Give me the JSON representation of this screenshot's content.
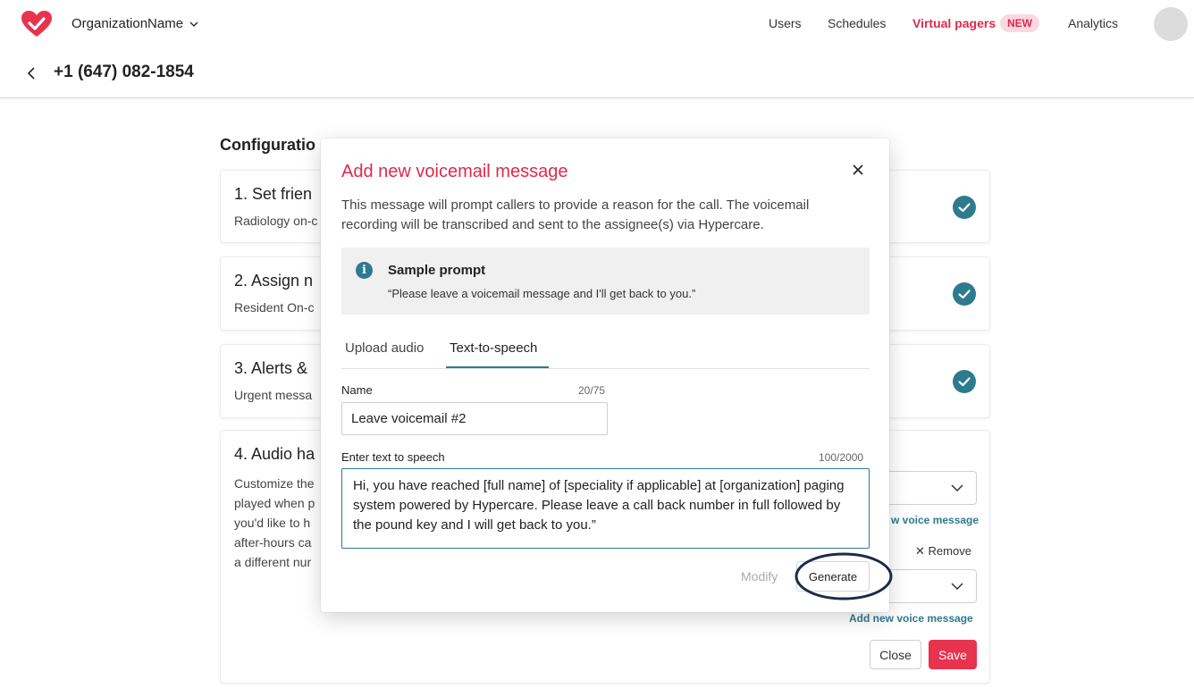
{
  "nav": {
    "org_name": "OrganizationName",
    "links": [
      "Users",
      "Schedules",
      "Virtual pagers",
      "Analytics"
    ],
    "badge_new": "NEW",
    "accent": "#e0294e"
  },
  "subheader": {
    "phone": "+1 (647) 082-1854"
  },
  "config": {
    "title": "Configuratio",
    "card1": {
      "title": "1. Set frien",
      "desc": "Radiology on-c"
    },
    "card2": {
      "title": "2. Assign n",
      "desc": "Resident On-c"
    },
    "card3": {
      "title": "3. Alerts &",
      "desc": "Urgent messa"
    },
    "card4": {
      "title": "4. Audio ha",
      "desc_lines": [
        "Customize the",
        "played when p",
        "you'd like to h",
        "after-hours ca",
        "a different nur"
      ],
      "add_link_1": "w voice message",
      "remove": "Remove",
      "add_link_2": "Add new voice message",
      "close": "Close",
      "save": "Save"
    },
    "check_color": "#2e7a8f"
  },
  "modal": {
    "title": "Add new voicemail message",
    "description": "This message will prompt callers to provide a reason for the call. The voicemail recording will be transcribed and sent to the assignee(s) via Hypercare.",
    "sample": {
      "title": "Sample prompt",
      "text": "“Please leave a voicemail message and I'll get back to you.”"
    },
    "tabs": [
      "Upload audio",
      "Text-to-speech"
    ],
    "active_tab": "Text-to-speech",
    "name_label": "Name",
    "name_counter": "20/75",
    "name_value": "Leave voicemail #2",
    "tts_label": "Enter text to speech",
    "tts_counter": "100/2000",
    "tts_value": "Hi, you have reached [full name] of [speciality if applicable] at [organization] paging system powered by Hypercare. Please leave a call back number in full followed by the pound key and I will get back to you.”",
    "modify": "Modify",
    "generate": "Generate"
  }
}
